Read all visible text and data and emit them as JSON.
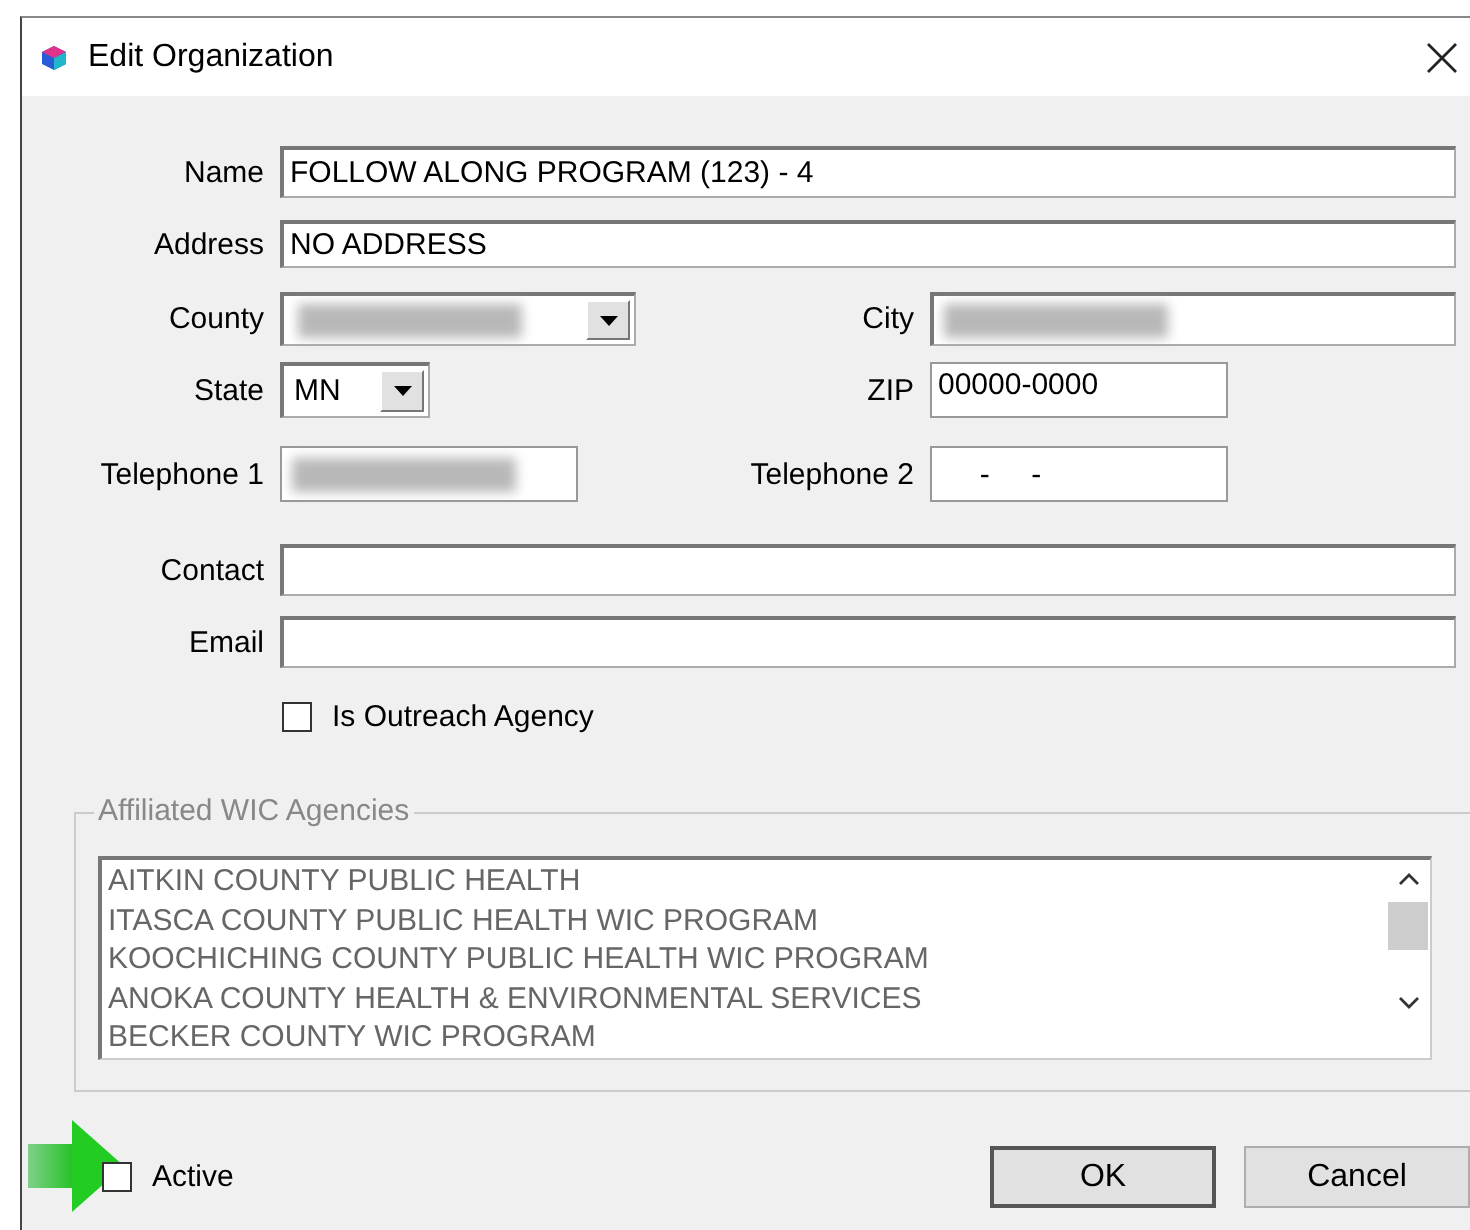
{
  "window": {
    "title": "Edit Organization"
  },
  "rows": [
    [
      {
        "label": "Name",
        "kind": "text",
        "value": "FOLLOW ALONG PROGRAM (123) - 4"
      }
    ],
    [
      {
        "label": "Address",
        "kind": "text",
        "value": "NO ADDRESS"
      }
    ],
    [
      {
        "label": "County",
        "kind": "combo",
        "redacted": true
      },
      {
        "label": "City",
        "kind": "text",
        "redacted": true
      }
    ],
    [
      {
        "label": "State",
        "kind": "combo",
        "value": "MN"
      },
      {
        "label": "ZIP",
        "kind": "text",
        "value": "00000-0000"
      }
    ],
    [
      {
        "label": "Telephone 1",
        "kind": "text",
        "redacted": true
      },
      {
        "label": "Telephone 2",
        "kind": "text",
        "value": "     -     -"
      }
    ],
    [
      {
        "label": "Contact",
        "kind": "text"
      }
    ],
    [
      {
        "label": "Email",
        "kind": "text"
      }
    ]
  ],
  "outreach_checkbox": {
    "label": "Is Outreach Agency",
    "checked": false
  },
  "agencies_group": {
    "title": "Affiliated WIC Agencies",
    "items": [
      "AITKIN COUNTY PUBLIC HEALTH",
      "ITASCA COUNTY PUBLIC HEALTH WIC PROGRAM",
      "KOOCHICHING COUNTY PUBLIC HEALTH WIC PROGRAM",
      "ANOKA COUNTY HEALTH & ENVIRONMENTAL SERVICES",
      "BECKER COUNTY WIC PROGRAM"
    ]
  },
  "active_checkbox": {
    "label": "Active",
    "checked": false
  },
  "buttons": [
    {
      "label": "OK",
      "default": true
    },
    {
      "label": "Cancel",
      "default": false
    }
  ]
}
